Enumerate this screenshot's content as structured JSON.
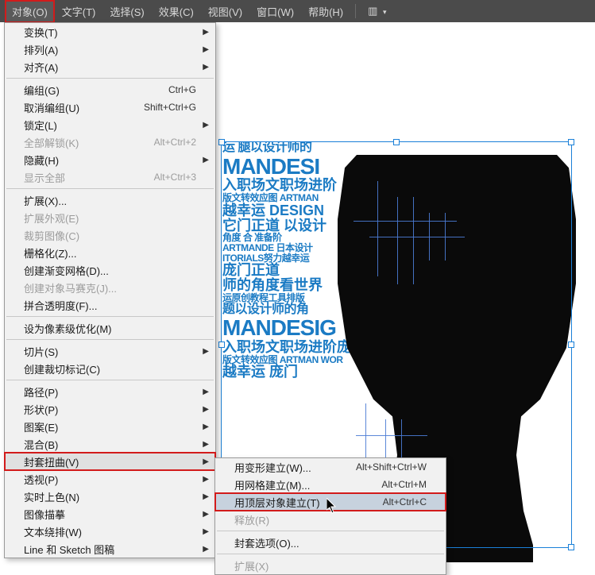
{
  "menubar": {
    "items": [
      {
        "label": "对象(O)",
        "active": true
      },
      {
        "label": "文字(T)"
      },
      {
        "label": "选择(S)"
      },
      {
        "label": "效果(C)"
      },
      {
        "label": "视图(V)"
      },
      {
        "label": "窗口(W)"
      },
      {
        "label": "帮助(H)"
      }
    ]
  },
  "dropdown": {
    "items": [
      {
        "label": "变换(T)",
        "submenu": true
      },
      {
        "label": "排列(A)",
        "submenu": true
      },
      {
        "label": "对齐(A)",
        "submenu": true
      },
      {
        "sep": true
      },
      {
        "label": "编组(G)",
        "shortcut": "Ctrl+G"
      },
      {
        "label": "取消编组(U)",
        "shortcut": "Shift+Ctrl+G"
      },
      {
        "label": "锁定(L)",
        "submenu": true
      },
      {
        "label": "全部解锁(K)",
        "shortcut": "Alt+Ctrl+2",
        "disabled": true
      },
      {
        "label": "隐藏(H)",
        "submenu": true
      },
      {
        "label": "显示全部",
        "shortcut": "Alt+Ctrl+3",
        "disabled": true
      },
      {
        "sep": true
      },
      {
        "label": "扩展(X)..."
      },
      {
        "label": "扩展外观(E)",
        "disabled": true
      },
      {
        "label": "裁剪图像(C)",
        "disabled": true
      },
      {
        "label": "栅格化(Z)..."
      },
      {
        "label": "创建渐变网格(D)..."
      },
      {
        "label": "创建对象马赛克(J)...",
        "disabled": true
      },
      {
        "label": "拼合透明度(F)..."
      },
      {
        "sep": true
      },
      {
        "label": "设为像素级优化(M)"
      },
      {
        "sep": true
      },
      {
        "label": "切片(S)",
        "submenu": true
      },
      {
        "label": "创建裁切标记(C)"
      },
      {
        "sep": true
      },
      {
        "label": "路径(P)",
        "submenu": true
      },
      {
        "label": "形状(P)",
        "submenu": true
      },
      {
        "label": "图案(E)",
        "submenu": true
      },
      {
        "label": "混合(B)",
        "submenu": true
      },
      {
        "label": "封套扭曲(V)",
        "submenu": true,
        "boxed": true
      },
      {
        "label": "透视(P)",
        "submenu": true
      },
      {
        "label": "实时上色(N)",
        "submenu": true
      },
      {
        "label": "图像描摹",
        "submenu": true
      },
      {
        "label": "文本绕排(W)",
        "submenu": true
      },
      {
        "label": "Line 和 Sketch 图稿",
        "submenu": true
      }
    ]
  },
  "submenu": {
    "items": [
      {
        "label": "用变形建立(W)...",
        "shortcut": "Alt+Shift+Ctrl+W"
      },
      {
        "label": "用网格建立(M)...",
        "shortcut": "Alt+Ctrl+M"
      },
      {
        "label": "用顶层对象建立(T)",
        "shortcut": "Alt+Ctrl+C",
        "highlight": true
      },
      {
        "label": "释放(R)",
        "disabled": true
      },
      {
        "sep": true
      },
      {
        "label": "封套选项(O)..."
      },
      {
        "sep": true
      },
      {
        "label": "扩展(X)",
        "disabled": true
      }
    ]
  },
  "text_cloud": {
    "l1": "运 腿以设计师的",
    "l2": "MANDESI",
    "l3": "入职场文职场进阶",
    "l4": "版文转效应图 ARTMAN",
    "l5": "越幸运 DESIGN",
    "l6": "它门正道 以设计",
    "l7": "角度 合 准备阶",
    "l8": "ARTMANDE 日本设计",
    "l9": "ITORIALS努力越幸运",
    "l10": "庞门正道",
    "l11": "师的角度看世界",
    "l12": "运原创教程工具排版",
    "l13": "题以设计师的角",
    "l14": "MANDESIG",
    "l15": "入职场文职场进阶庞",
    "l16": "版文转效应图 ARTMAN WOR",
    "l17": "越幸运 庞门"
  }
}
